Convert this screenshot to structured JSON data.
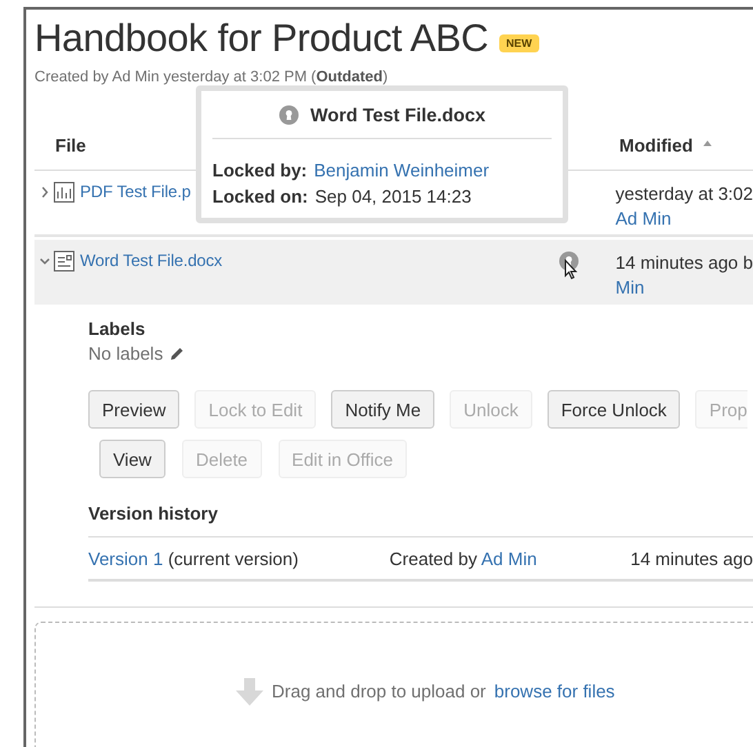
{
  "page": {
    "title": "Handbook for Product ABC",
    "badge": "NEW",
    "meta": "Created by Ad Min yesterday at 3:02 PM (**Outdated**)"
  },
  "table": {
    "columns": [
      {
        "label": "File",
        "sorted": false
      },
      {
        "label": "Modified",
        "sorted": true
      }
    ],
    "rows": [
      {
        "name": "PDF Test File.p",
        "kind": "pdf",
        "expanded": false,
        "locked": false,
        "selected": false,
        "modified": "yesterday at 3:02",
        "modified_by": "Ad Min"
      },
      {
        "name": "Word Test File.docx",
        "kind": "word",
        "expanded": true,
        "locked": true,
        "selected": true,
        "modified": "14 minutes ago b",
        "modified_by": "Min"
      }
    ]
  },
  "details": {
    "labels_heading": "Labels",
    "labels_value": "No labels",
    "button_rows": [
      [
        {
          "label": "Preview",
          "disabled": false
        },
        {
          "label": "Lock to Edit",
          "disabled": true
        },
        {
          "label": "Notify Me",
          "disabled": false
        },
        {
          "label": "Unlock",
          "disabled": true
        },
        {
          "label": "Force Unlock",
          "disabled": false
        },
        {
          "label": "Prop",
          "disabled": true
        }
      ],
      [
        {
          "label": "View",
          "disabled": false
        },
        {
          "label": "Delete",
          "disabled": true
        },
        {
          "label": "Edit in Office",
          "disabled": true
        }
      ]
    ],
    "version_history": {
      "heading": "Version history",
      "versions": [
        {
          "version": "Version 1",
          "note": "(current version)",
          "created_prefix": "Created by",
          "author": "Ad Min",
          "time": "14 minutes ago"
        }
      ]
    }
  },
  "dropzone": {
    "text": "Drag and drop to upload or",
    "link": "browse for files"
  },
  "popup": {
    "title": "Word Test File.docx",
    "rows": [
      {
        "label": "Locked by:",
        "value": "Benjamin Weinheimer",
        "kind": "link"
      },
      {
        "label": "Locked on:",
        "value": "Sep 04, 2015 14:23",
        "kind": "text"
      }
    ]
  }
}
